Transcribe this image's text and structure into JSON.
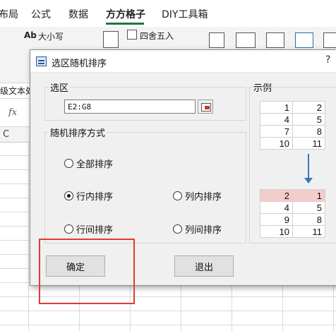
{
  "ribbon": {
    "tabs": [
      "布局",
      "公式",
      "数据",
      "方方格子",
      "DIY工具箱"
    ],
    "active_tab": "方方格子",
    "commands": {
      "font_case": "大小写",
      "round": "四舍五入",
      "ab_icon": "Ab",
      "advanced_text": "级文本处"
    },
    "accent_color": "#217346"
  },
  "formula_bar": {
    "fx": "fx",
    "column_header": "C"
  },
  "dialog": {
    "title": "选区随机排序",
    "help": "?",
    "selection_group": "选区",
    "range_value": "E2:G8",
    "mode_group": "随机排序方式",
    "options": {
      "all": "全部排序",
      "in_row": "行内排序",
      "in_column": "列内排序",
      "between_rows": "行间排序",
      "between_columns": "列间排序"
    },
    "selected_option": "in_row",
    "ok_label": "确定",
    "exit_label": "退出",
    "example_group": "示例",
    "example_before": [
      [
        "1",
        "2"
      ],
      [
        "4",
        "5"
      ],
      [
        "7",
        "8"
      ],
      [
        "10",
        "11"
      ]
    ],
    "example_after": [
      [
        "2",
        "1"
      ],
      [
        "4",
        "5"
      ],
      [
        "9",
        "8"
      ],
      [
        "10",
        "11"
      ]
    ],
    "highlight_color": "#f4cccc",
    "annotation_color": "#e03a30"
  }
}
